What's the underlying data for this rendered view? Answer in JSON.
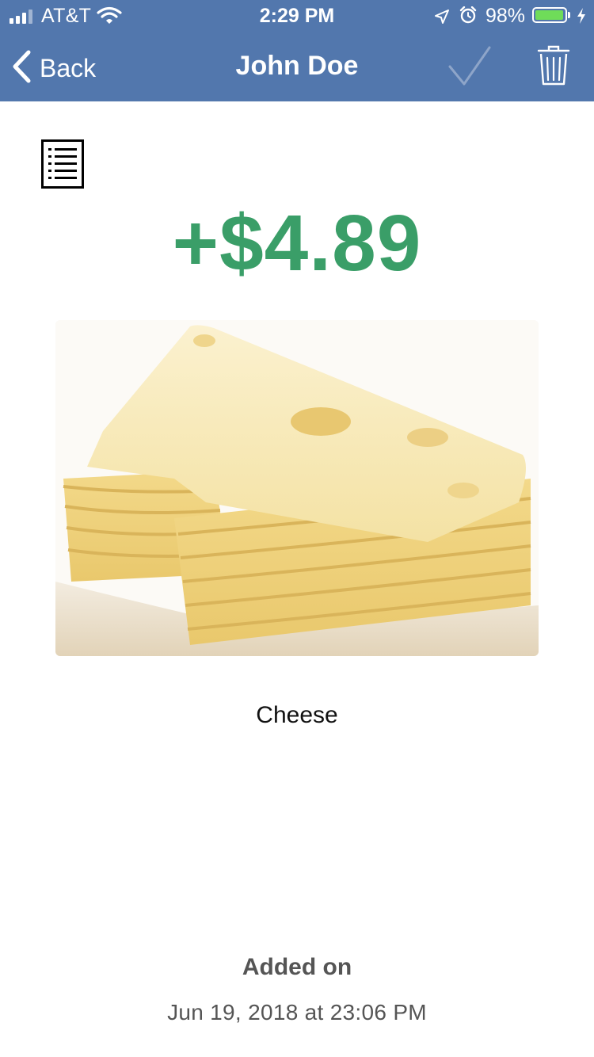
{
  "status_bar": {
    "carrier": "AT&T",
    "time": "2:29 PM",
    "battery_percent": "98%",
    "battery_level": 0.98,
    "signal_bars_active": 3,
    "signal_bars_total": 4
  },
  "nav": {
    "back_label": "Back",
    "title": "John Doe",
    "icons": {
      "back": "chevron-left-icon",
      "confirm": "checkmark-icon",
      "delete": "trash-icon"
    }
  },
  "transaction": {
    "list_icon": "list-icon",
    "amount": "+$4.89",
    "amount_color": "#3a9e68",
    "item_name": "Cheese",
    "added_label": "Added on",
    "added_date": "Jun 19, 2018 at 23:06 PM"
  },
  "colors": {
    "nav_background": "#5277ad",
    "battery_fill": "#6fdc59"
  }
}
